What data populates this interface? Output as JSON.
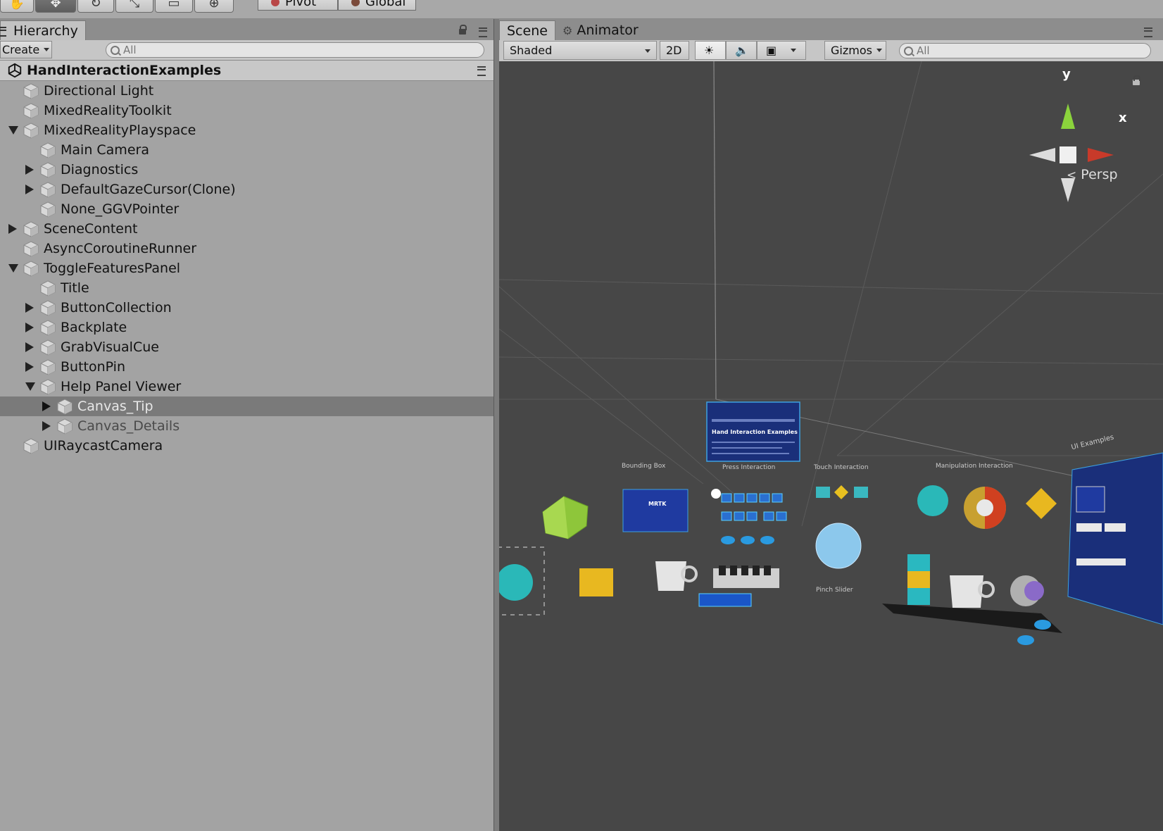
{
  "toolbar": {
    "pivot_label": "Pivot",
    "global_label": "Global"
  },
  "hierarchy": {
    "tab_label": "Hierarchy",
    "create_label": "Create",
    "search_placeholder": "All",
    "scene_name": "HandInteractionExamples",
    "items": [
      {
        "label": "Directional Light",
        "depth": 0,
        "expander": "none",
        "state": "normal"
      },
      {
        "label": "MixedRealityToolkit",
        "depth": 0,
        "expander": "none",
        "state": "normal"
      },
      {
        "label": "MixedRealityPlayspace",
        "depth": 0,
        "expander": "expanded",
        "state": "normal"
      },
      {
        "label": "Main Camera",
        "depth": 1,
        "expander": "none",
        "state": "normal"
      },
      {
        "label": "Diagnostics",
        "depth": 1,
        "expander": "collapsed",
        "state": "normal"
      },
      {
        "label": "DefaultGazeCursor(Clone)",
        "depth": 1,
        "expander": "collapsed",
        "state": "normal"
      },
      {
        "label": "None_GGVPointer",
        "depth": 1,
        "expander": "none",
        "state": "normal"
      },
      {
        "label": "SceneContent",
        "depth": 0,
        "expander": "collapsed",
        "state": "normal"
      },
      {
        "label": "AsyncCoroutineRunner",
        "depth": 0,
        "expander": "none",
        "state": "normal"
      },
      {
        "label": "ToggleFeaturesPanel",
        "depth": 0,
        "expander": "expanded",
        "state": "normal"
      },
      {
        "label": "Title",
        "depth": 1,
        "expander": "none",
        "state": "normal"
      },
      {
        "label": "ButtonCollection",
        "depth": 1,
        "expander": "collapsed",
        "state": "normal"
      },
      {
        "label": "Backplate",
        "depth": 1,
        "expander": "collapsed",
        "state": "normal"
      },
      {
        "label": "GrabVisualCue",
        "depth": 1,
        "expander": "collapsed",
        "state": "normal"
      },
      {
        "label": "ButtonPin",
        "depth": 1,
        "expander": "collapsed",
        "state": "normal"
      },
      {
        "label": "Help Panel Viewer",
        "depth": 1,
        "expander": "expanded",
        "state": "normal"
      },
      {
        "label": "Canvas_Tip",
        "depth": 2,
        "expander": "collapsed",
        "state": "selected"
      },
      {
        "label": "Canvas_Details",
        "depth": 2,
        "expander": "collapsed",
        "state": "inactive"
      },
      {
        "label": "UIRaycastCamera",
        "depth": 0,
        "expander": "none",
        "state": "normal"
      }
    ]
  },
  "scene": {
    "tab_scene": "Scene",
    "tab_animator": "Animator",
    "shading_mode": "Shaded",
    "mode_2d": "2D",
    "gizmos_label": "Gizmos",
    "search_placeholder": "All",
    "projection_label": "Persp",
    "gizmo_axes": {
      "x": "x",
      "y": "y"
    },
    "labels": {
      "bounding_box": "Bounding Box",
      "press_interaction": "Press Interaction",
      "touch_interaction": "Touch Interaction",
      "manipulation_interaction": "Manipulation Interaction",
      "hand_interaction_examples": "Hand Interaction Examples",
      "pinch_slider": "Pinch Slider",
      "ui_examples": "UI Examples",
      "mrtk": "MRTK"
    }
  },
  "colors": {
    "selected_row": "#7a7a7a",
    "viewport_bg": "#474747",
    "axis_x": "#c83a2a",
    "axis_y": "#8bd33c",
    "accent_blue": "#1a2f7a"
  }
}
